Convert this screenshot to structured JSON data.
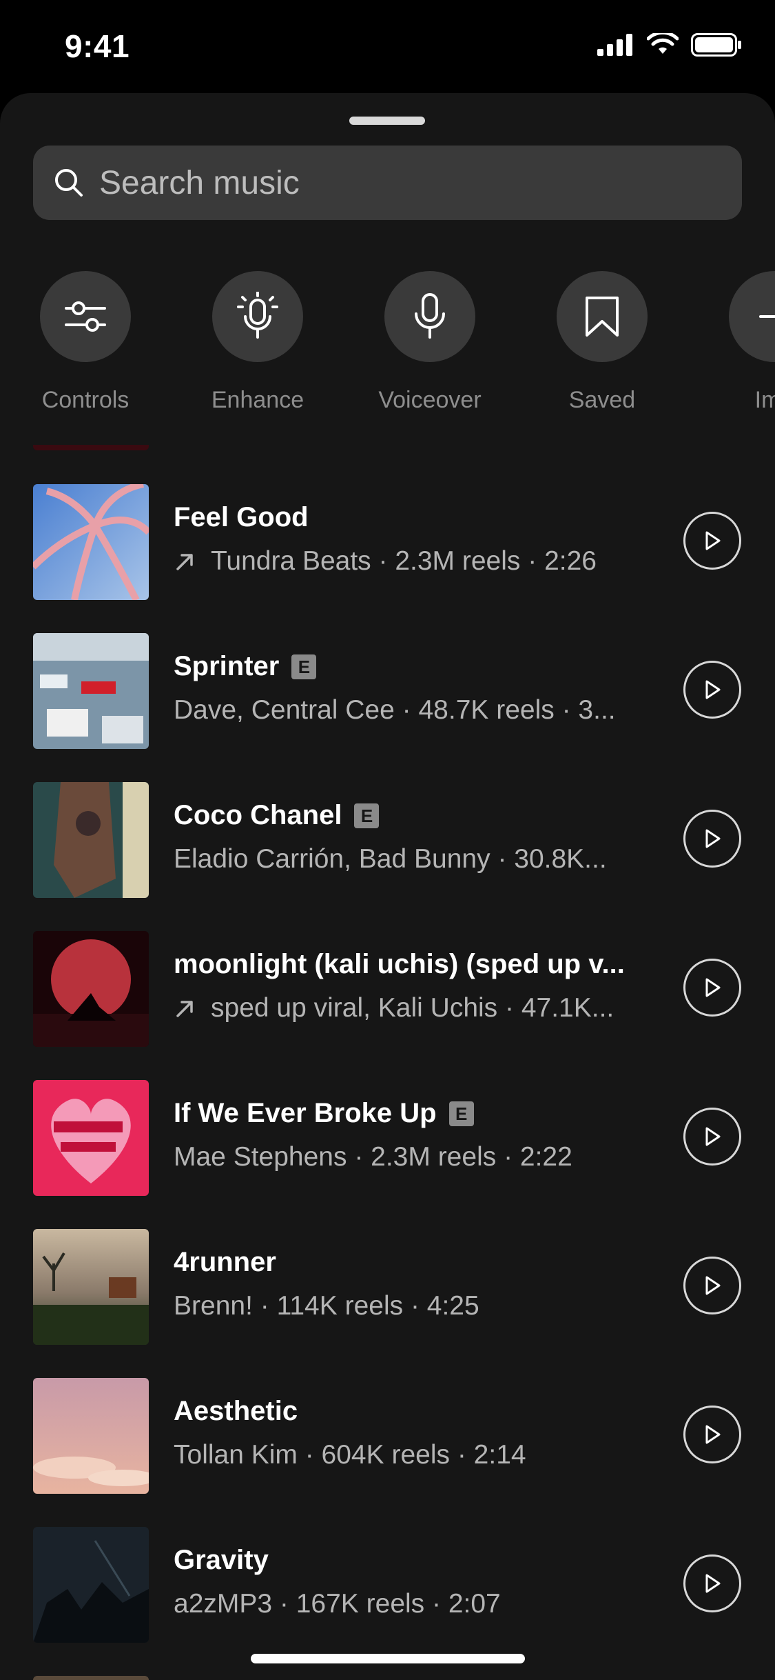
{
  "status": {
    "time": "9:41"
  },
  "search": {
    "placeholder": "Search music"
  },
  "actions": [
    {
      "label": "Controls",
      "icon": "sliders-icon"
    },
    {
      "label": "Enhance",
      "icon": "mic-sparkle-icon"
    },
    {
      "label": "Voiceover",
      "icon": "microphone-icon"
    },
    {
      "label": "Saved",
      "icon": "bookmark-icon"
    },
    {
      "label": "Imp",
      "icon": "import-icon"
    }
  ],
  "songs": [
    {
      "title": "Feel Good",
      "explicit": false,
      "trending": true,
      "subtitle": "Tundra Beats · 2.3M reels · 2:26"
    },
    {
      "title": "Sprinter",
      "explicit": true,
      "trending": false,
      "subtitle": "Dave, Central Cee · 48.7K reels · 3..."
    },
    {
      "title": "Coco Chanel",
      "explicit": true,
      "trending": false,
      "subtitle": "Eladio Carrión, Bad Bunny · 30.8K..."
    },
    {
      "title": "moonlight (kali uchis) (sped up v...",
      "explicit": false,
      "trending": true,
      "subtitle": "sped up viral, Kali Uchis · 47.1K..."
    },
    {
      "title": "If We Ever Broke Up",
      "explicit": true,
      "trending": false,
      "subtitle": "Mae Stephens · 2.3M reels · 2:22"
    },
    {
      "title": "4runner",
      "explicit": false,
      "trending": false,
      "subtitle": "Brenn! · 114K reels · 4:25"
    },
    {
      "title": "Aesthetic",
      "explicit": false,
      "trending": false,
      "subtitle": "Tollan Kim · 604K reels · 2:14"
    },
    {
      "title": "Gravity",
      "explicit": false,
      "trending": false,
      "subtitle": "a2zMP3 · 167K reels · 2:07"
    }
  ],
  "explicit_badge": "E",
  "colors": {
    "sheet": "#161616",
    "control": "#3a3a3a",
    "muted_text": "#8e8e8e"
  }
}
